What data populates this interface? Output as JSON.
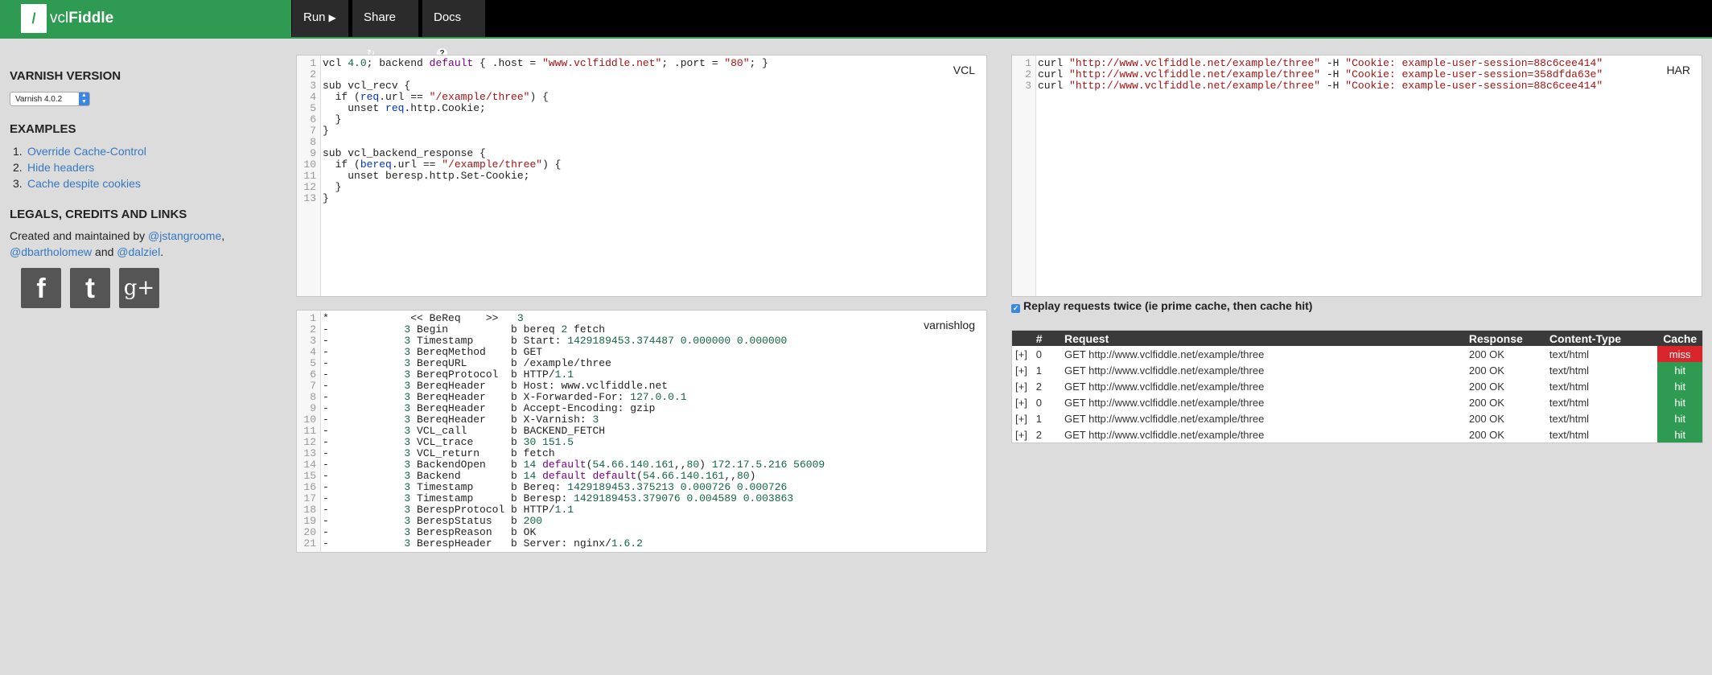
{
  "brand": {
    "logo_glyph": "/",
    "name_prefix": "vcl",
    "name_bold": "Fiddle"
  },
  "nav": {
    "run": "Run",
    "share": "Share",
    "docs": "Docs"
  },
  "sidebar": {
    "version_heading": "VARNISH VERSION",
    "version_selected": "Varnish 4.0.2",
    "examples_heading": "EXAMPLES",
    "examples": [
      {
        "num": "1.",
        "label": "Override Cache-Control"
      },
      {
        "num": "2.",
        "label": "Hide headers"
      },
      {
        "num": "3.",
        "label": "Cache despite cookies"
      }
    ],
    "legal_heading": "LEGALS, CREDITS AND LINKS",
    "credits_text": "Created and maintained by",
    "credit_1": "@jstangroome",
    "credit_sep": ",",
    "credit_2": "@dbartholomew",
    "credit_and": "and",
    "credit_3": "@dalziel",
    "credit_end": ".",
    "social": {
      "facebook": "f",
      "twitter": "t",
      "googleplus": "g+"
    }
  },
  "vcl_panel": {
    "label": "VCL"
  },
  "har_panel": {
    "label": "HAR"
  },
  "log_panel": {
    "label": "varnishlog"
  },
  "replay": {
    "label": "Replay requests twice (ie prime cache, then cache hit)",
    "checked": true
  },
  "results": {
    "headers": [
      "",
      "#",
      "Request",
      "Response",
      "Content-Type",
      "Cache"
    ],
    "rows": [
      {
        "exp": "[+]",
        "num": "0",
        "request": "GET http://www.vclfiddle.net/example/three",
        "response": "200 OK",
        "content_type": "text/html",
        "cache": "miss"
      },
      {
        "exp": "[+]",
        "num": "1",
        "request": "GET http://www.vclfiddle.net/example/three",
        "response": "200 OK",
        "content_type": "text/html",
        "cache": "hit"
      },
      {
        "exp": "[+]",
        "num": "2",
        "request": "GET http://www.vclfiddle.net/example/three",
        "response": "200 OK",
        "content_type": "text/html",
        "cache": "hit"
      },
      {
        "exp": "[+]",
        "num": "0",
        "request": "GET http://www.vclfiddle.net/example/three",
        "response": "200 OK",
        "content_type": "text/html",
        "cache": "hit"
      },
      {
        "exp": "[+]",
        "num": "1",
        "request": "GET http://www.vclfiddle.net/example/three",
        "response": "200 OK",
        "content_type": "text/html",
        "cache": "hit"
      },
      {
        "exp": "[+]",
        "num": "2",
        "request": "GET http://www.vclfiddle.net/example/three",
        "response": "200 OK",
        "content_type": "text/html",
        "cache": "hit"
      }
    ]
  },
  "colors": {
    "brand_green": "#2e9a52",
    "miss_red": "#d9262d",
    "link_blue": "#3578c0"
  }
}
